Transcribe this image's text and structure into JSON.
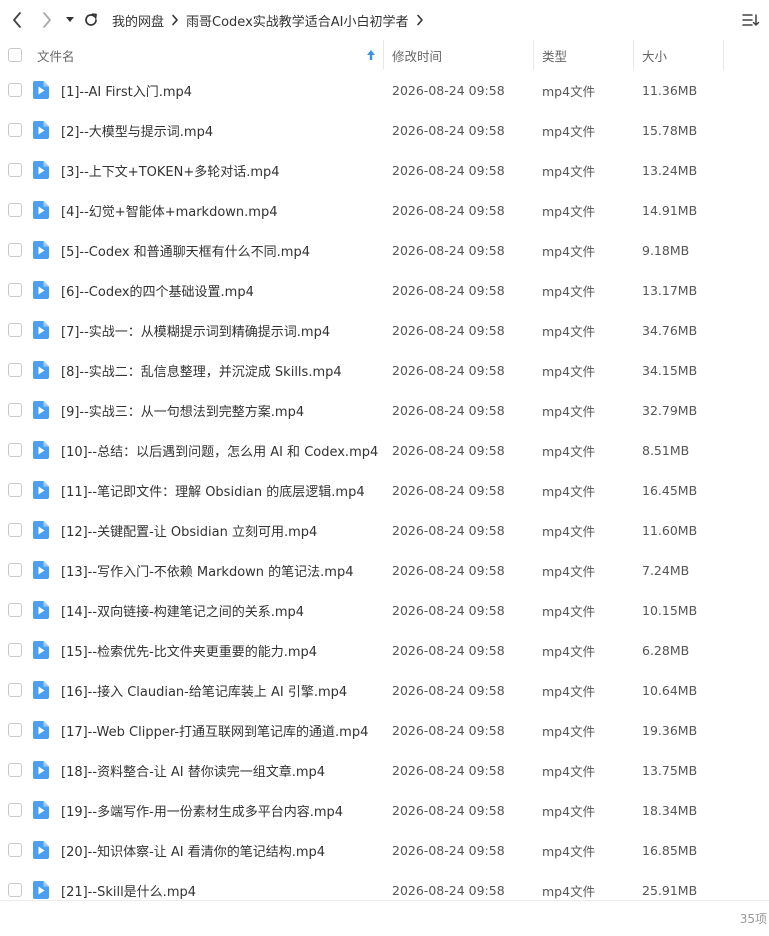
{
  "nav": {
    "back_icon": "chevron-left-icon",
    "forward_icon": "chevron-right-icon",
    "dropdown_icon": "caret-down-icon",
    "refresh_icon": "refresh-icon"
  },
  "breadcrumb": [
    "我的网盘",
    "雨哥Codex实战教学适合AI小白初学者"
  ],
  "header": {
    "name": "文件名",
    "time": "修改时间",
    "type": "类型",
    "size": "大小"
  },
  "colors": {
    "accent": "#3c8fee",
    "icon_blue": "#4a9ff0"
  },
  "files": [
    {
      "name": "[1]--AI First入门.mp4",
      "time": "2026-08-24 09:58",
      "type": "mp4文件",
      "size": "11.36MB"
    },
    {
      "name": "[2]--大模型与提示词.mp4",
      "time": "2026-08-24 09:58",
      "type": "mp4文件",
      "size": "15.78MB"
    },
    {
      "name": "[3]--上下文+TOKEN+多轮对话.mp4",
      "time": "2026-08-24 09:58",
      "type": "mp4文件",
      "size": "13.24MB"
    },
    {
      "name": "[4]--幻觉+智能体+markdown.mp4",
      "time": "2026-08-24 09:58",
      "type": "mp4文件",
      "size": "14.91MB"
    },
    {
      "name": "[5]--Codex 和普通聊天框有什么不同.mp4",
      "time": "2026-08-24 09:58",
      "type": "mp4文件",
      "size": "9.18MB"
    },
    {
      "name": "[6]--Codex的四个基础设置.mp4",
      "time": "2026-08-24 09:58",
      "type": "mp4文件",
      "size": "13.17MB"
    },
    {
      "name": "[7]--实战一：从模糊提示词到精确提示词.mp4",
      "time": "2026-08-24 09:58",
      "type": "mp4文件",
      "size": "34.76MB"
    },
    {
      "name": "[8]--实战二：乱信息整理，并沉淀成 Skills.mp4",
      "time": "2026-08-24 09:58",
      "type": "mp4文件",
      "size": "34.15MB"
    },
    {
      "name": "[9]--实战三：从一句想法到完整方案.mp4",
      "time": "2026-08-24 09:58",
      "type": "mp4文件",
      "size": "32.79MB"
    },
    {
      "name": "[10]--总结：以后遇到问题，怎么用 AI 和 Codex.mp4",
      "time": "2026-08-24 09:58",
      "type": "mp4文件",
      "size": "8.51MB"
    },
    {
      "name": "[11]--笔记即文件：理解 Obsidian 的底层逻辑.mp4",
      "time": "2026-08-24 09:58",
      "type": "mp4文件",
      "size": "16.45MB"
    },
    {
      "name": "[12]--关键配置-让 Obsidian 立刻可用.mp4",
      "time": "2026-08-24 09:58",
      "type": "mp4文件",
      "size": "11.60MB"
    },
    {
      "name": "[13]--写作入门-不依赖 Markdown 的笔记法.mp4",
      "time": "2026-08-24 09:58",
      "type": "mp4文件",
      "size": "7.24MB"
    },
    {
      "name": "[14]--双向链接-构建笔记之间的关系.mp4",
      "time": "2026-08-24 09:58",
      "type": "mp4文件",
      "size": "10.15MB"
    },
    {
      "name": "[15]--检索优先-比文件夹更重要的能力.mp4",
      "time": "2026-08-24 09:58",
      "type": "mp4文件",
      "size": "6.28MB"
    },
    {
      "name": "[16]--接入 Claudian-给笔记库装上 AI 引擎.mp4",
      "time": "2026-08-24 09:58",
      "type": "mp4文件",
      "size": "10.64MB"
    },
    {
      "name": "[17]--Web Clipper-打通互联网到笔记库的通道.mp4",
      "time": "2026-08-24 09:58",
      "type": "mp4文件",
      "size": "19.36MB"
    },
    {
      "name": "[18]--资料整合-让 AI 替你读完一组文章.mp4",
      "time": "2026-08-24 09:58",
      "type": "mp4文件",
      "size": "13.75MB"
    },
    {
      "name": "[19]--多端写作-用一份素材生成多平台内容.mp4",
      "time": "2026-08-24 09:58",
      "type": "mp4文件",
      "size": "18.34MB"
    },
    {
      "name": "[20]--知识体察-让 AI 看清你的笔记结构.mp4",
      "time": "2026-08-24 09:58",
      "type": "mp4文件",
      "size": "16.85MB"
    },
    {
      "name": "[21]--Skill是什么.mp4",
      "time": "2026-08-24 09:58",
      "type": "mp4文件",
      "size": "25.91MB"
    }
  ],
  "footer": {
    "count": "35项"
  }
}
